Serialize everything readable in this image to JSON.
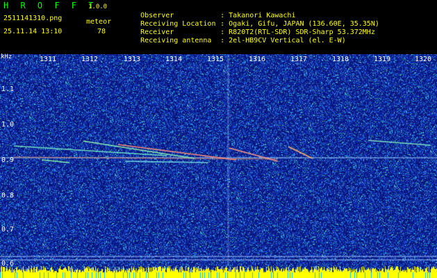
{
  "header": {
    "app_title": "H R O F F T",
    "app_version": "1.0.0",
    "filename": "2511141310.png",
    "datetime": "25.11.14 13:10",
    "meteor_label": "meteor",
    "meteor_count": "78"
  },
  "info": [
    {
      "key": "Observer",
      "value": ": Takanori Kawachi"
    },
    {
      "key": "Receiving Location",
      "value": ": Ogaki, Gifu, JAPAN (136.60E, 35.35N)"
    },
    {
      "key": "Receiver",
      "value": ": R820T2(RTL-SDR) SDR-Sharp 53.372MHz"
    },
    {
      "key": "Receiving antenna",
      "value": ": 2el-HB9CV Vertical (el. E-W)"
    }
  ],
  "axis": {
    "unit": "kHz",
    "minute_labels": [
      "1311",
      "1312",
      "1313",
      "1314",
      "1315",
      "1316",
      "1317",
      "1318",
      "1319",
      "1320"
    ],
    "freq_labels": [
      "1.1",
      "1.0",
      "0.9",
      "0.8",
      "0.7",
      "0.6"
    ]
  },
  "colors": {
    "background": "#000000",
    "noise_bg": "#0a1a8c",
    "header_text": "#ffff00",
    "title_text": "#00ff00",
    "baseline": "#ffff00",
    "gridline": "#a0c0ff"
  }
}
